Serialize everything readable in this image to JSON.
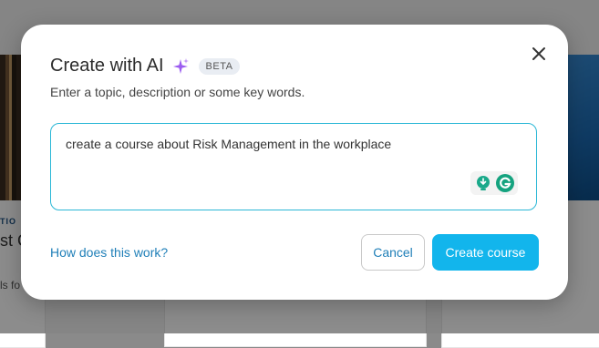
{
  "background": {
    "left_card": {
      "tag": "TIO",
      "title": "st C",
      "text": "ls fo"
    }
  },
  "modal": {
    "title": "Create with AI",
    "badge": "BETA",
    "subtitle": "Enter a topic, description or some key words.",
    "prompt_value": "create a course about Risk Management in the workplace",
    "help_link": "How does this work?",
    "cancel_label": "Cancel",
    "create_label": "Create course"
  },
  "icons": {
    "sparkle": "sparkle-icon",
    "close": "close-icon",
    "lightbulb": "lightbulb-icon",
    "grammarly": "grammarly-icon"
  },
  "colors": {
    "accent": "#12b5ec",
    "link": "#1f7fb8",
    "sparkle": "#9b5cf0",
    "input_border": "#2bb7d6"
  }
}
